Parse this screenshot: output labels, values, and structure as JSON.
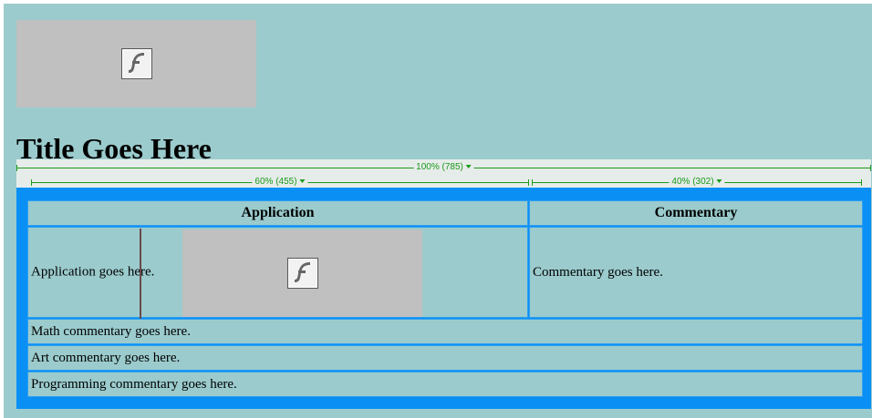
{
  "header": {
    "flash_icon": "flash-player-icon",
    "title": "Title Goes Here"
  },
  "ruler": {
    "full_label": "100% (785)",
    "left_label": "60% (455)",
    "right_label": "40% (302)"
  },
  "table": {
    "columns": [
      "Application",
      "Commentary"
    ],
    "application_text": "Application goes here.",
    "application_icon": "flash-player-icon",
    "commentary_text": "Commentary goes here.",
    "rows": [
      "Math commentary goes here.",
      "Art commentary goes here.",
      "Programming commentary goes here."
    ]
  },
  "colors": {
    "page_background": "#9bcbcd",
    "table_border": "#0a90f5",
    "ruler_green": "#1a9a1a",
    "placeholder_gray": "#c0c0c0"
  }
}
